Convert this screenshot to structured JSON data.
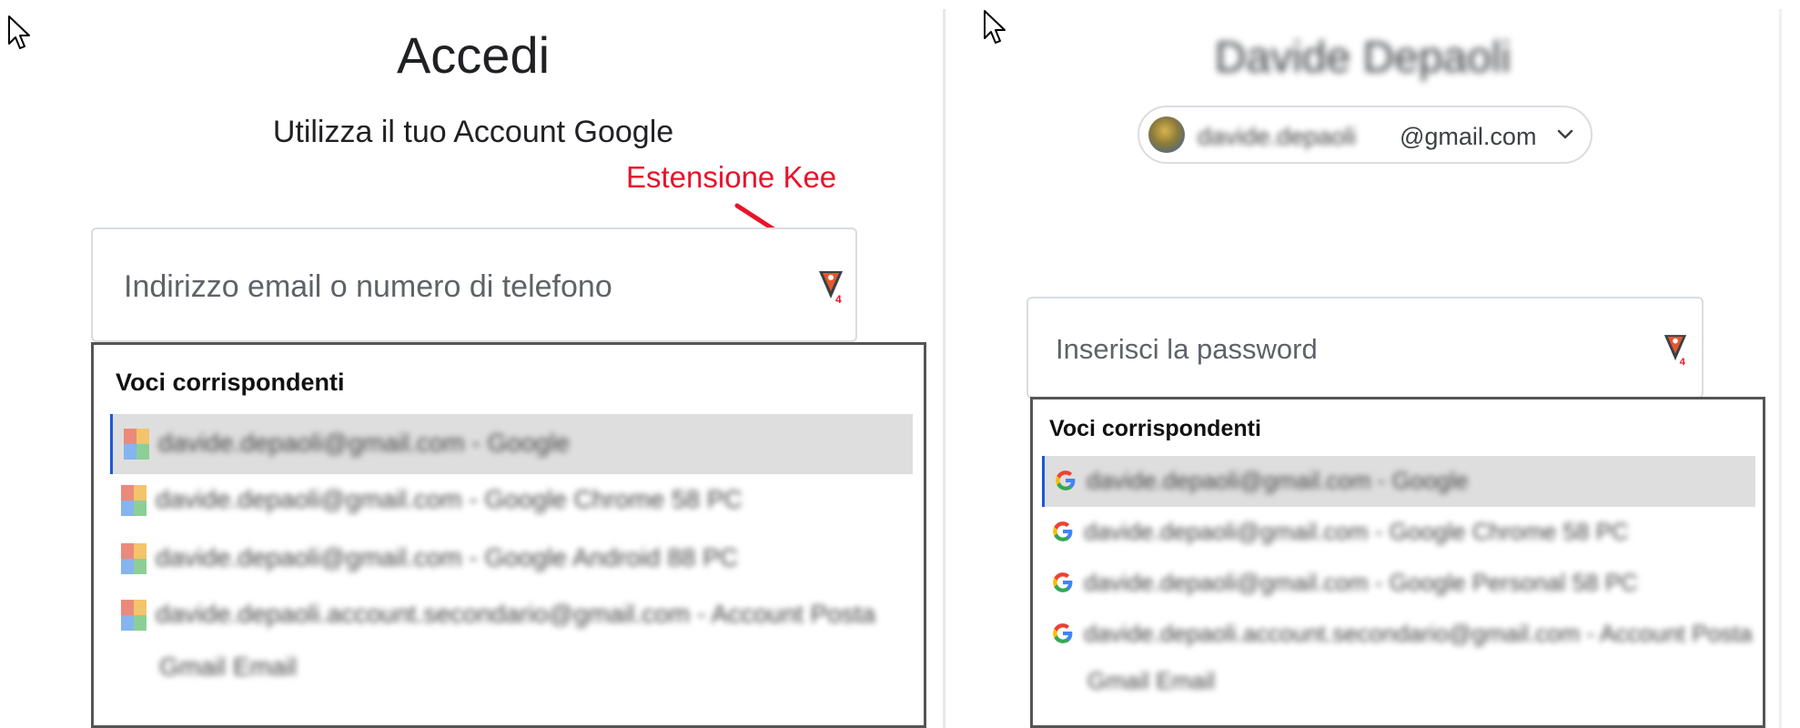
{
  "left_panel": {
    "title": "Accedi",
    "subtitle": "Utilizza il tuo Account Google",
    "annotation": "Estensione Kee",
    "email_field": {
      "placeholder": "Indirizzo email o numero di telefono"
    },
    "kee_badge": "4",
    "dropdown": {
      "header": "Voci corrispondenti",
      "entries": [
        {
          "text": "davide.depaoli@gmail.com - Google"
        },
        {
          "text": "davide.depaoli@gmail.com - Google Chrome 58 PC"
        },
        {
          "text": "davide.depaoli@gmail.com - Google Android 88 PC"
        },
        {
          "text": "davide.depaoli.account.secondario@gmail.com - Account Posta"
        },
        {
          "text": "Gmail Email"
        }
      ]
    }
  },
  "right_panel": {
    "profile_name": "Davide Depaoli",
    "account_chip": {
      "email_hidden": "davide.depaoli",
      "email_domain": "@gmail.com"
    },
    "password_field": {
      "placeholder": "Inserisci la password"
    },
    "kee_badge": "4",
    "dropdown": {
      "header": "Voci corrispondenti",
      "entries": [
        {
          "text": "davide.depaoli@gmail.com - Google"
        },
        {
          "text": "davide.depaoli@gmail.com - Google Chrome 58 PC"
        },
        {
          "text": "davide.depaoli@gmail.com - Google Personal 58 PC"
        },
        {
          "text": "davide.depaoli.account.secondario@gmail.com - Account Posta"
        },
        {
          "text": "Gmail Email"
        }
      ]
    }
  },
  "colors": {
    "annotation_red": "#e8132b",
    "selection_bar": "#1a57d6",
    "selected_row": "#dedede",
    "kee_orange": "#e4572e"
  }
}
